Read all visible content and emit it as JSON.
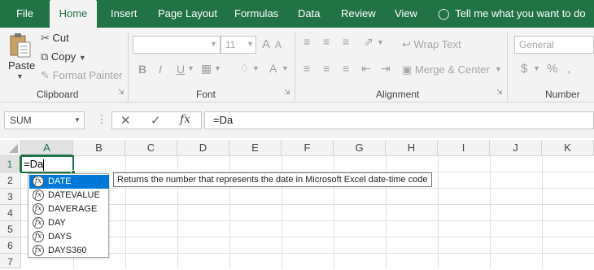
{
  "tabs": [
    {
      "label": "File",
      "active": false
    },
    {
      "label": "Home",
      "active": true
    },
    {
      "label": "Insert",
      "active": false
    },
    {
      "label": "Page Layout",
      "active": false
    },
    {
      "label": "Formulas",
      "active": false
    },
    {
      "label": "Data",
      "active": false
    },
    {
      "label": "Review",
      "active": false
    },
    {
      "label": "View",
      "active": false
    }
  ],
  "tell_me": "Tell me what you want to do",
  "clipboard": {
    "paste": "Paste",
    "cut": "Cut",
    "copy": "Copy",
    "format_painter": "Format Painter",
    "group": "Clipboard"
  },
  "font": {
    "size": "11",
    "group": "Font",
    "bold": "B",
    "italic": "I",
    "underline": "U",
    "grow": "A",
    "shrink": "A",
    "font_color": "A"
  },
  "alignment": {
    "wrap_text": "Wrap Text",
    "merge_center": "Merge & Center",
    "group": "Alignment"
  },
  "number": {
    "format": "General",
    "currency": "$",
    "percent": "%",
    "group": "Number"
  },
  "formula_bar": {
    "name_box": "SUM",
    "formula": "=Da",
    "fx": "fx"
  },
  "columns": [
    "A",
    "B",
    "C",
    "D",
    "E",
    "F",
    "G",
    "H",
    "I",
    "J",
    "K"
  ],
  "rows": [
    "1",
    "2",
    "3",
    "4",
    "5",
    "6",
    "7"
  ],
  "active_cell_text": "=Da",
  "autocomplete": {
    "items": [
      "DATE",
      "DATEVALUE",
      "DAVERAGE",
      "DAY",
      "DAYS",
      "DAYS360"
    ],
    "selected_index": 0,
    "tooltip": "Returns the number that represents the date in Microsoft Excel date-time code"
  },
  "colors": {
    "brand": "#217346",
    "selection": "#0078d7"
  }
}
